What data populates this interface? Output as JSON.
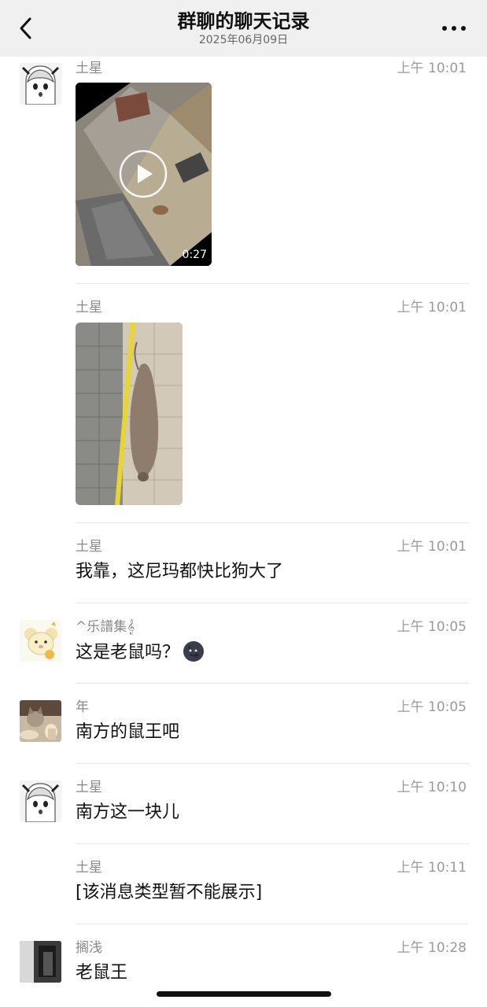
{
  "header": {
    "title": "群聊的聊天记录",
    "subtitle": "2025年06月09日",
    "back_icon": "chevron-left-icon",
    "more_icon": "more-horizontal-icon"
  },
  "messages": [
    {
      "sender": "土星",
      "time": "上午 10:01",
      "type": "video",
      "duration": "0:27"
    },
    {
      "sender": "土星",
      "time": "上午 10:01",
      "type": "image"
    },
    {
      "sender": "土星",
      "time": "上午 10:01",
      "type": "text",
      "text": "我靠，这尼玛都快比狗大了"
    },
    {
      "sender": "^乐譜集𝄞",
      "time": "上午 10:05",
      "type": "text",
      "text": "这是老鼠吗？",
      "emoji": "new-moon-face-emoji"
    },
    {
      "sender": "年",
      "time": "上午 10:05",
      "type": "text",
      "text": "南方的鼠王吧"
    },
    {
      "sender": "土星",
      "time": "上午 10:10",
      "type": "text",
      "text": "南方这一块儿"
    },
    {
      "sender": "土星",
      "time": "上午 10:11",
      "type": "text",
      "text": "[该消息类型暂不能展示]"
    },
    {
      "sender": "搁浅",
      "time": "上午 10:28",
      "type": "text",
      "text": "老鼠王"
    }
  ]
}
